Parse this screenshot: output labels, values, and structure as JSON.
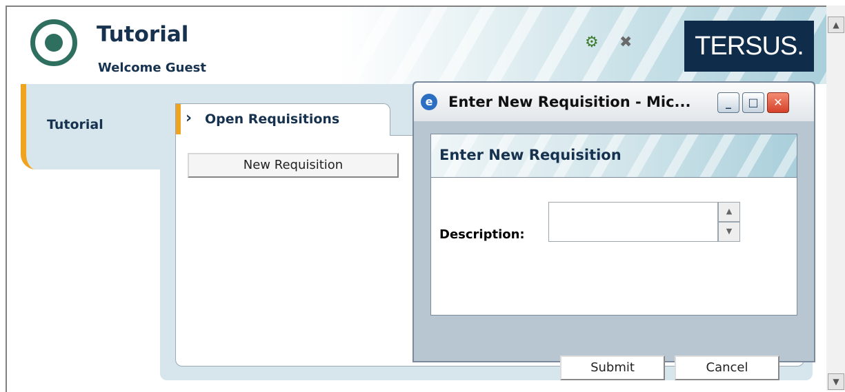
{
  "header": {
    "title": "Tutorial",
    "welcome": "Welcome Guest",
    "brand": "TERSUS.",
    "icons": [
      "tools-icon",
      "disabled-network-icon"
    ]
  },
  "sidebar": {
    "items": [
      {
        "label": "Tutorial",
        "selected": true
      }
    ]
  },
  "tabs": [
    {
      "label": "Open Requisitions",
      "active": true
    }
  ],
  "main": {
    "new_requisition_label": "New Requisition"
  },
  "dialog": {
    "window_title": "Enter New Requisition - Mic...",
    "heading": "Enter New Requisition",
    "description_label": "Description:",
    "description_value": "",
    "submit_label": "Submit",
    "cancel_label": "Cancel"
  },
  "colors": {
    "accent": "#f0a31f",
    "brand_bg": "#0f2d4a",
    "header_text": "#16324f",
    "panel_bg": "#d6e6ec",
    "close_button": "#d5412a"
  }
}
